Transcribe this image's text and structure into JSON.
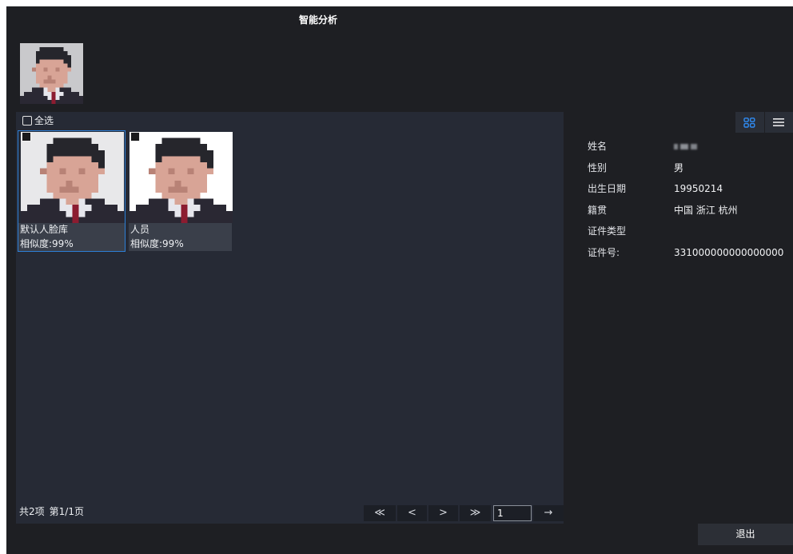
{
  "window": {
    "title": "智能分析"
  },
  "query": {
    "photo_icon": "face-photo"
  },
  "results": {
    "select_all_label": "全选",
    "cards": [
      {
        "library": "默认人脸库",
        "similarity": "相似度:99%",
        "selected": true
      },
      {
        "library": "人员",
        "similarity": "相似度:99%",
        "selected": false
      }
    ],
    "summary": {
      "total": "共2项",
      "page": "第1/1页"
    },
    "pagination": {
      "first": "≪",
      "prev": "<",
      "next": ">",
      "last": "≫",
      "page_input": "1",
      "go": "→"
    }
  },
  "view_toggle": {
    "grid_icon": "grid-icon",
    "list_icon": "list-icon",
    "active": "grid"
  },
  "details": [
    {
      "label": "姓名",
      "value": ""
    },
    {
      "label": "性别",
      "value": "男"
    },
    {
      "label": "出生日期",
      "value": "19950214"
    },
    {
      "label": "籍贯",
      "value": "中国 浙江 杭州"
    },
    {
      "label": "证件类型",
      "value": ""
    },
    {
      "label": "证件号:",
      "value": "331000000000000000"
    }
  ],
  "actions": {
    "exit_label": "退出"
  },
  "colors": {
    "window_bg": "#1e1f23",
    "panel_bg": "#262a35",
    "selected_border": "#2d7fd6",
    "accent": "#2f8cf5"
  }
}
